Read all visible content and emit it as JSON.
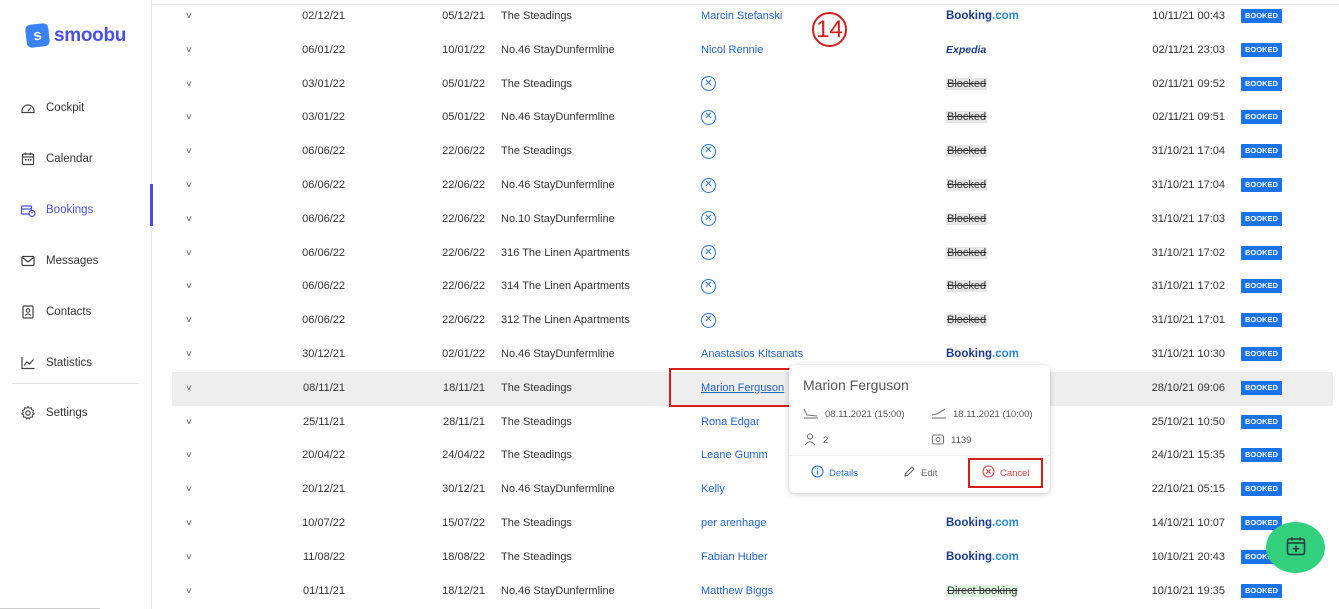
{
  "app": {
    "logo_letter": "s",
    "logo_text": "smoobu",
    "brand_color": "#4a4fe4"
  },
  "sidebar": {
    "items": [
      {
        "label": "Cockpit",
        "icon": "gauge-icon"
      },
      {
        "label": "Calendar",
        "icon": "calendar-icon"
      },
      {
        "label": "Bookings",
        "icon": "bookings-icon",
        "active": true
      },
      {
        "label": "Messages",
        "icon": "envelope-icon"
      },
      {
        "label": "Contacts",
        "icon": "contact-card-icon"
      },
      {
        "label": "Statistics",
        "icon": "chart-icon"
      }
    ],
    "settings_label": "Settings"
  },
  "annotation": {
    "marker": "14"
  },
  "bookings": [
    {
      "arrival": "02/12/21",
      "departure": "05/12/21",
      "property": "The Steadings",
      "guest": "Marcin Stefanski",
      "channel": "booking",
      "created": "10/11/21 00:43",
      "status": "BOOKED"
    },
    {
      "arrival": "06/01/22",
      "departure": "10/01/22",
      "property": "No.46 StayDunfermline",
      "guest": "Nicol Rennie",
      "channel": "expedia",
      "created": "02/11/21 23:03",
      "status": "BOOKED"
    },
    {
      "arrival": "03/01/22",
      "departure": "05/01/22",
      "property": "The Steadings",
      "guest": "",
      "channel": "blocked",
      "created": "02/11/21 09:52",
      "status": "BOOKED"
    },
    {
      "arrival": "03/01/22",
      "departure": "05/01/22",
      "property": "No.46 StayDunfermline",
      "guest": "",
      "channel": "blocked",
      "created": "02/11/21 09:51",
      "status": "BOOKED"
    },
    {
      "arrival": "06/06/22",
      "departure": "22/06/22",
      "property": "The Steadings",
      "guest": "",
      "channel": "blocked",
      "created": "31/10/21 17:04",
      "status": "BOOKED"
    },
    {
      "arrival": "06/06/22",
      "departure": "22/06/22",
      "property": "No.46 StayDunfermline",
      "guest": "",
      "channel": "blocked",
      "created": "31/10/21 17:04",
      "status": "BOOKED"
    },
    {
      "arrival": "06/06/22",
      "departure": "22/06/22",
      "property": "No.10 StayDunfermline",
      "guest": "",
      "channel": "blocked",
      "created": "31/10/21 17:03",
      "status": "BOOKED"
    },
    {
      "arrival": "06/06/22",
      "departure": "22/06/22",
      "property": "316 The Linen Apartments",
      "guest": "",
      "channel": "blocked",
      "created": "31/10/21 17:02",
      "status": "BOOKED"
    },
    {
      "arrival": "06/06/22",
      "departure": "22/06/22",
      "property": "314 The Linen Apartments",
      "guest": "",
      "channel": "blocked",
      "created": "31/10/21 17:02",
      "status": "BOOKED"
    },
    {
      "arrival": "06/06/22",
      "departure": "22/06/22",
      "property": "312 The Linen Apartments",
      "guest": "",
      "channel": "blocked",
      "created": "31/10/21 17:01",
      "status": "BOOKED"
    },
    {
      "arrival": "30/12/21",
      "departure": "02/01/22",
      "property": "No.46 StayDunfermline",
      "guest": "Anastasios Kitsanats",
      "channel": "booking",
      "created": "31/10/21 10:30",
      "status": "BOOKED"
    },
    {
      "arrival": "08/11/21",
      "departure": "18/11/21",
      "property": "The Steadings",
      "guest": "Marion Ferguson",
      "channel": "",
      "created": "28/10/21 09:06",
      "status": "BOOKED",
      "highlighted": true
    },
    {
      "arrival": "25/11/21",
      "departure": "28/11/21",
      "property": "The Steadings",
      "guest": "Rona Edgar",
      "channel": "",
      "created": "25/10/21 10:50",
      "status": "BOOKED"
    },
    {
      "arrival": "20/04/22",
      "departure": "24/04/22",
      "property": "The Steadings",
      "guest": "Leane Gumm",
      "channel": "",
      "created": "24/10/21 15:35",
      "status": "BOOKED"
    },
    {
      "arrival": "20/12/21",
      "departure": "30/12/21",
      "property": "No.46 StayDunfermline",
      "guest": "Kelly",
      "channel": "",
      "created": "22/10/21 05:15",
      "status": "BOOKED"
    },
    {
      "arrival": "10/07/22",
      "departure": "15/07/22",
      "property": "The Steadings",
      "guest": "per arenhage",
      "channel": "booking",
      "created": "14/10/21 10:07",
      "status": "BOOKED"
    },
    {
      "arrival": "11/08/22",
      "departure": "18/08/22",
      "property": "The Steadings",
      "guest": "Fabian Huber",
      "channel": "booking",
      "created": "10/10/21 20:43",
      "status": "BOOKED"
    },
    {
      "arrival": "01/11/21",
      "departure": "18/12/21",
      "property": "No.46 StayDunfermline",
      "guest": "Matthew Biggs",
      "channel": "direct",
      "created": "10/10/21 19:35",
      "status": "BOOKED"
    }
  ],
  "channels": {
    "booking_a": "Booking",
    "booking_b": ".com",
    "expedia": "Expedia",
    "blocked": "Blocked",
    "direct": "Direct booking"
  },
  "popover": {
    "name": "Marion Ferguson",
    "checkin": "08.11.2021 (15:00)",
    "checkout": "18.11.2021 (10:00)",
    "guests": "2",
    "price": "1139",
    "details_label": "Details",
    "edit_label": "Edit",
    "cancel_label": "Cancel"
  },
  "colors": {
    "badge": "#1a73e8",
    "link": "#2563c9",
    "fab": "#33d07d",
    "annotation_red": "#d21f1f"
  }
}
